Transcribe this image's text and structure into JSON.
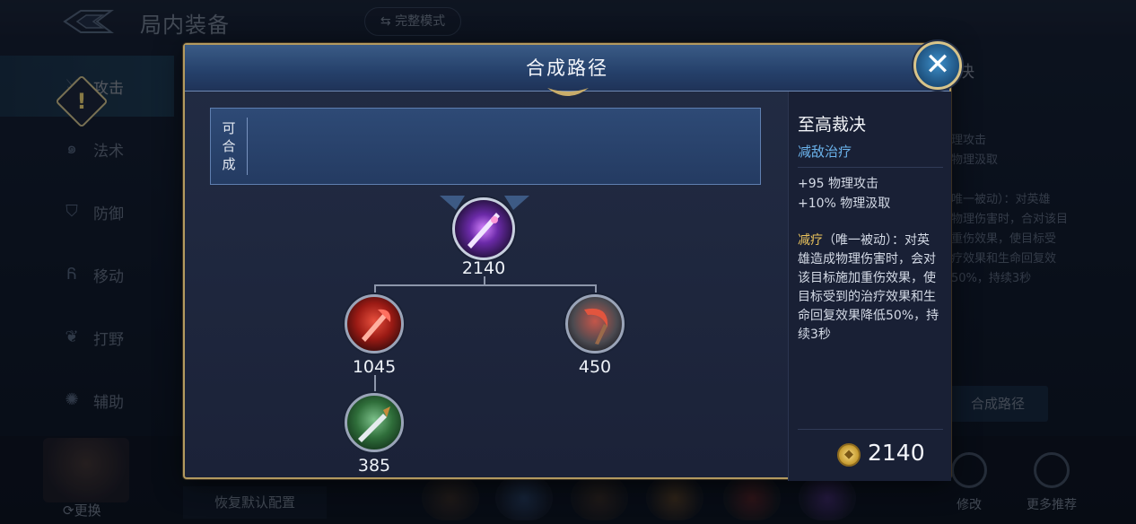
{
  "background": {
    "title": "局内装备",
    "mode_button": "⇆ 完整模式",
    "sidebar": [
      {
        "label": "攻击",
        "icon": "sword-icon",
        "glyph": "⚔"
      },
      {
        "label": "法术",
        "icon": "spiral-icon",
        "glyph": "๑"
      },
      {
        "label": "防御",
        "icon": "shield-icon",
        "glyph": "⛉"
      },
      {
        "label": "移动",
        "icon": "boot-icon",
        "glyph": "Ᏺ"
      },
      {
        "label": "打野",
        "icon": "claw-icon",
        "glyph": "❦"
      },
      {
        "label": "辅助",
        "icon": "support-icon",
        "glyph": "✺"
      }
    ],
    "warn_glyph": "!",
    "swap_label": "⟳更换",
    "restore_button": "恢复默认配置",
    "right_title": "决",
    "right_text": "理攻击\n物理汲取\n\n唯一被动）：对英雄\n物理伤害时，合对该目\n重伤效果，使目标受\n疗效果和生命回复效\n50%，持续3秒",
    "craft_path_button": "合成路径",
    "modify_label": "修改",
    "recommend_label": "更多推荐"
  },
  "modal": {
    "title": "合成路径",
    "close_glyph": "✕",
    "craftable_label": "可合成",
    "tree": {
      "main": {
        "price": "2140",
        "icon": "purple-blade-icon"
      },
      "a": {
        "price": "1045",
        "icon": "red-axe-icon"
      },
      "b": {
        "price": "450",
        "icon": "scythe-icon"
      },
      "c": {
        "price": "385",
        "icon": "green-dagger-icon"
      }
    },
    "info": {
      "name": "至高裁决",
      "tag": "减敌治疗",
      "stat1": "+95 物理攻击",
      "stat2": "+10% 物理汲取",
      "passive_name": "减疗",
      "passive_text": "（唯一被动）：对英雄造成物理伤害时，会对该目标施加重伤效果，使目标受到的治疗效果和生命回复效果降低50%，持续3秒",
      "coin_glyph": "◆",
      "total_price": "2140"
    }
  },
  "colors": {
    "accent_gold": "#b39a5f",
    "tag_blue": "#6bb3ec",
    "passive_gold": "#e9c25c"
  }
}
